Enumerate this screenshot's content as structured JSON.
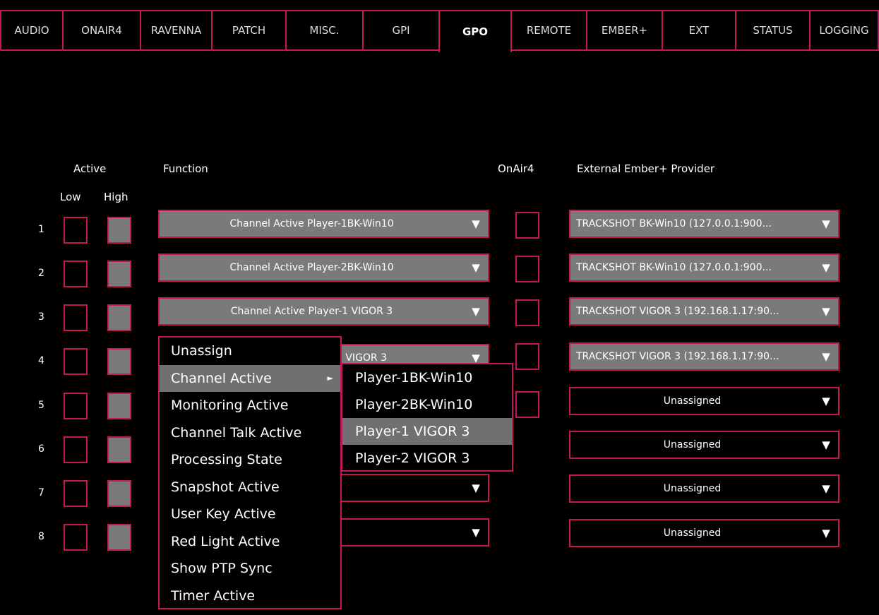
{
  "tabs": [
    {
      "label": "AUDIO",
      "active": false
    },
    {
      "label": "ONAIR4",
      "active": false
    },
    {
      "label": "RAVENNA",
      "active": false
    },
    {
      "label": "PATCH",
      "active": false
    },
    {
      "label": "MISC.",
      "active": false
    },
    {
      "label": "GPI",
      "active": false
    },
    {
      "label": "GPO",
      "active": true
    },
    {
      "label": "REMOTE",
      "active": false
    },
    {
      "label": "EMBER+",
      "active": false
    },
    {
      "label": "EXT",
      "active": false
    },
    {
      "label": "STATUS",
      "active": false
    },
    {
      "label": "LOGGING",
      "active": false
    }
  ],
  "headers": {
    "active": "Active",
    "low": "Low",
    "high": "High",
    "function": "Function",
    "onair4": "OnAir4",
    "provider": "External Ember+ Provider"
  },
  "arrow_glyph": "▼",
  "rows": [
    {
      "num": "1",
      "function": "Channel Active Player-1BK-Win10",
      "provider": "TRACKSHOT BK-Win10 (127.0.0.1:900..."
    },
    {
      "num": "2",
      "function": "Channel Active Player-2BK-Win10",
      "provider": "TRACKSHOT BK-Win10 (127.0.0.1:900..."
    },
    {
      "num": "3",
      "function": "Channel Active Player-1 VIGOR 3",
      "provider": "TRACKSHOT VIGOR 3 (192.168.1.17:90..."
    },
    {
      "num": "4",
      "function": "2 VIGOR 3",
      "provider": "TRACKSHOT VIGOR 3 (192.168.1.17:90..."
    },
    {
      "num": "5",
      "function": "",
      "provider": "Unassigned"
    },
    {
      "num": "6",
      "function": "",
      "provider": "Unassigned"
    },
    {
      "num": "7",
      "function": "",
      "provider": "Unassigned"
    },
    {
      "num": "8",
      "function": "",
      "provider": "Unassigned"
    }
  ],
  "function_menu": {
    "items": [
      {
        "label": "Unassign"
      },
      {
        "label": "Channel Active",
        "highlighted": true,
        "submenu_glyph": "►"
      },
      {
        "label": "Monitoring Active"
      },
      {
        "label": "Channel Talk Active"
      },
      {
        "label": "Processing State"
      },
      {
        "label": "Snapshot Active"
      },
      {
        "label": "User Key Active"
      },
      {
        "label": "Red Light Active"
      },
      {
        "label": "Show PTP Sync"
      },
      {
        "label": "Timer Active"
      }
    ]
  },
  "channel_submenu": {
    "items": [
      {
        "label": "Player-1BK-Win10"
      },
      {
        "label": "Player-2BK-Win10"
      },
      {
        "label": "Player-1 VIGOR 3",
        "highlighted": true
      },
      {
        "label": "Player-2 VIGOR 3"
      }
    ]
  },
  "colors": {
    "accent": "#c2185b",
    "gray": "#7a7a7a",
    "highlight": "#707070",
    "background": "#000000"
  }
}
